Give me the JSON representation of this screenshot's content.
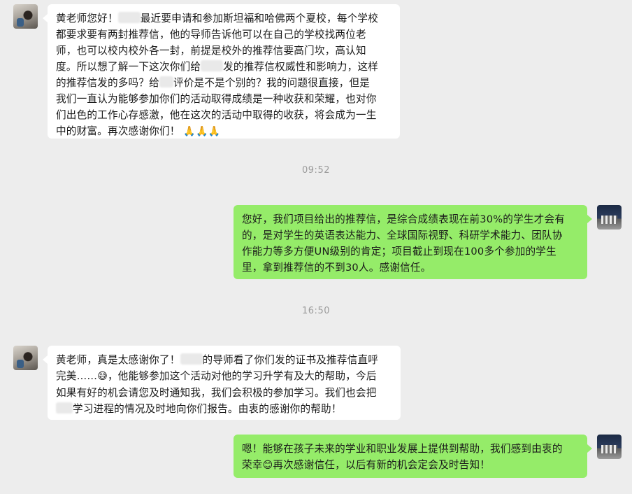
{
  "messages": [
    {
      "sender": "left",
      "avatar": "parent-avatar",
      "lines": [
        [
          "黄老师您好！",
          "",
          "最近要申请和参加斯坦福和哈佛两个夏校，每个学校"
        ],
        [
          "都要求要有两封推荐信，他的导师告诉他可以在自己的学校找两位老"
        ],
        [
          "师，也可以校内校外各一封，前提是校外的推荐信要高门坎，高认知"
        ],
        [
          "度。所以想了解一下这次你们给",
          "",
          "发的推荐信权威性和影响力，这样"
        ],
        [
          "的推荐信发的多吗？给",
          "",
          "评价是不是个别的？我的问题很直接，但是"
        ],
        [
          "我们一直认为能够参加你们的活动取得成绩是一种收获和荣耀，也对你"
        ],
        [
          "们出色的工作心存感激，他在这次的活动中取得的收获，将会成为一生"
        ],
        [
          "中的财富。再次感谢你们！",
          "🙏🙏🙏"
        ]
      ]
    },
    {
      "sender": "right",
      "avatar": "teacher-avatar",
      "lines": [
        [
          "您好，我们项目给出的推荐信，是综合成绩表现在前30%的学生才会有"
        ],
        [
          "的，是对学生的英语表达能力、全球国际视野、科研学术能力、团队协"
        ],
        [
          "作能力等多方便UN级别的肯定；项目截止到现在100多个参加的学生"
        ],
        [
          "里，拿到推荐信的不到30人。感谢信任。"
        ]
      ]
    },
    {
      "sender": "left",
      "avatar": "parent-avatar",
      "lines": [
        [
          "黄老师，真是太感谢你了！",
          "",
          "的导师看了你们发的证书及推荐信直呼"
        ],
        [
          "完美……",
          "😅",
          "，他能够参加这个活动对他的学习升学有及大的帮助，今后"
        ],
        [
          "如果有好的机会请您及时通知我，我们会积极的参加学习。我们也会把"
        ],
        [
          "",
          "",
          "学习进程的情况及时地向你们报告。由衷的感谢你的帮助！"
        ]
      ]
    },
    {
      "sender": "right",
      "avatar": "teacher-avatar",
      "lines": [
        [
          "嗯！能够在孩子未来的学业和职业发展上提供到帮助，我们感到由衷的"
        ],
        [
          "荣幸",
          "😊",
          "再次感谢信任，以后有新的机会定会及时告知！"
        ]
      ]
    }
  ],
  "timestamps": [
    "09:52",
    "16:50"
  ],
  "colors": {
    "background": "#ededed",
    "left_bubble": "#ffffff",
    "right_bubble": "#95ec69",
    "timestamp_text": "#9b9b9b"
  }
}
